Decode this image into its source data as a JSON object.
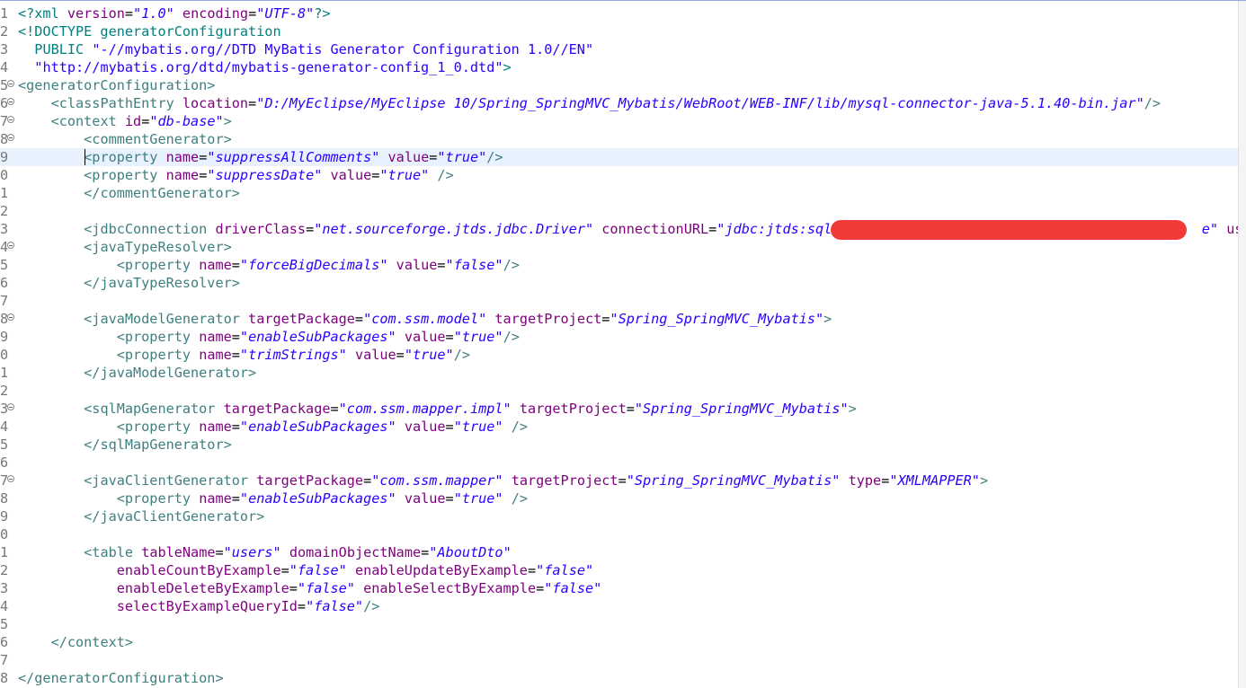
{
  "editor": {
    "active_line": 9,
    "lines": [
      {
        "n": "1",
        "fold": false,
        "html": "<span class=\"d\">&lt;?xml</span> <span class=\"a\">version</span>=<span class=\"v\">\"1.0\"</span> <span class=\"a\">encoding</span>=<span class=\"v\">\"UTF-8\"</span><span class=\"d\">?&gt;</span>"
      },
      {
        "n": "2",
        "fold": false,
        "html": "<span class=\"d\">&lt;!DOCTYPE generatorConfiguration</span>"
      },
      {
        "n": "3",
        "fold": false,
        "html": "  <span class=\"d\">PUBLIC</span> <span class=\"v\" style=\"font-style:normal\">\"-//mybatis.org//DTD MyBatis Generator Configuration 1.0//EN\"</span>"
      },
      {
        "n": "4",
        "fold": false,
        "html": "  <span class=\"v\" style=\"font-style:normal\">\"http://mybatis.org/dtd/mybatis-generator-config_1_0.dtd\"</span><span class=\"d\">&gt;</span>"
      },
      {
        "n": "5",
        "fold": true,
        "html": "<span class=\"t\">&lt;generatorConfiguration&gt;</span>"
      },
      {
        "n": "6",
        "fold": true,
        "html": "    <span class=\"t\">&lt;classPathEntry</span> <span class=\"a\">location</span>=<span class=\"v\">\"D:/MyEclipse/MyEclipse 10/Spring_SpringMVC_Mybatis/WebRoot/WEB-INF/lib/mysql-connector-java-5.1.40-bin.jar\"</span><span class=\"t\">/&gt;</span>"
      },
      {
        "n": "7",
        "fold": true,
        "html": "    <span class=\"t\">&lt;context</span> <span class=\"a\">id</span>=<span class=\"v\">\"db-base\"</span><span class=\"t\">&gt;</span>"
      },
      {
        "n": "8",
        "fold": true,
        "html": "        <span class=\"t\">&lt;commentGenerator&gt;</span>"
      },
      {
        "n": "9",
        "fold": false,
        "html": "        <span class=\"t\">&lt;property</span> <span class=\"a\">name</span>=<span class=\"v\">\"suppressAllComments\"</span> <span class=\"a\">value</span>=<span class=\"v\">\"true\"</span><span class=\"t\">/&gt;</span>"
      },
      {
        "n": "0",
        "fold": false,
        "html": "        <span class=\"t\">&lt;property</span> <span class=\"a\">name</span>=<span class=\"v\">\"suppressDate\"</span> <span class=\"a\">value</span>=<span class=\"v\">\"true\"</span> <span class=\"t\">/&gt;</span>"
      },
      {
        "n": "1",
        "fold": false,
        "html": "        <span class=\"t\">&lt;/commentGenerator&gt;</span>"
      },
      {
        "n": "2",
        "fold": false,
        "html": ""
      },
      {
        "n": "3",
        "fold": false,
        "html": "        <span class=\"t\">&lt;jdbcConnection</span> <span class=\"a\">driverClass</span>=<span class=\"v\">\"net.sourceforge.jtds.jdbc.Driver\"</span> <span class=\"a\">connectionURL</span>=<span class=\"v\">\"jdbc:jtds:sqlserv</span>                                         <span class=\"v\">e\"</span> <span class=\"a\">user</span>"
      },
      {
        "n": "4",
        "fold": true,
        "html": "        <span class=\"t\">&lt;javaTypeResolver&gt;</span>"
      },
      {
        "n": "5",
        "fold": false,
        "html": "            <span class=\"t\">&lt;property</span> <span class=\"a\">name</span>=<span class=\"v\">\"forceBigDecimals\"</span> <span class=\"a\">value</span>=<span class=\"v\">\"false\"</span><span class=\"t\">/&gt;</span>"
      },
      {
        "n": "6",
        "fold": false,
        "html": "        <span class=\"t\">&lt;/javaTypeResolver&gt;</span>"
      },
      {
        "n": "7",
        "fold": false,
        "html": ""
      },
      {
        "n": "8",
        "fold": true,
        "html": "        <span class=\"t\">&lt;javaModelGenerator</span> <span class=\"a\">targetPackage</span>=<span class=\"v\">\"com.ssm.model\"</span> <span class=\"a\">targetProject</span>=<span class=\"v\">\"Spring_SpringMVC_Mybatis\"</span><span class=\"t\">&gt;</span>"
      },
      {
        "n": "9",
        "fold": false,
        "html": "            <span class=\"t\">&lt;property</span> <span class=\"a\">name</span>=<span class=\"v\">\"enableSubPackages\"</span> <span class=\"a\">value</span>=<span class=\"v\">\"true\"</span><span class=\"t\">/&gt;</span>"
      },
      {
        "n": "0",
        "fold": false,
        "html": "            <span class=\"t\">&lt;property</span> <span class=\"a\">name</span>=<span class=\"v\">\"trimStrings\"</span> <span class=\"a\">value</span>=<span class=\"v\">\"true\"</span><span class=\"t\">/&gt;</span>"
      },
      {
        "n": "1",
        "fold": false,
        "html": "        <span class=\"t\">&lt;/javaModelGenerator&gt;</span>"
      },
      {
        "n": "2",
        "fold": false,
        "html": ""
      },
      {
        "n": "3",
        "fold": true,
        "html": "        <span class=\"t\">&lt;sqlMapGenerator</span> <span class=\"a\">targetPackage</span>=<span class=\"v\">\"com.ssm.mapper.impl\"</span> <span class=\"a\">targetProject</span>=<span class=\"v\">\"Spring_SpringMVC_Mybatis\"</span><span class=\"t\">&gt;</span>"
      },
      {
        "n": "4",
        "fold": false,
        "html": "            <span class=\"t\">&lt;property</span> <span class=\"a\">name</span>=<span class=\"v\">\"enableSubPackages\"</span> <span class=\"a\">value</span>=<span class=\"v\">\"true\"</span> <span class=\"t\">/&gt;</span>"
      },
      {
        "n": "5",
        "fold": false,
        "html": "        <span class=\"t\">&lt;/sqlMapGenerator&gt;</span>"
      },
      {
        "n": "6",
        "fold": false,
        "html": ""
      },
      {
        "n": "7",
        "fold": true,
        "html": "        <span class=\"t\">&lt;javaClientGenerator</span> <span class=\"a\">targetPackage</span>=<span class=\"v\">\"com.ssm.mapper\"</span> <span class=\"a\">targetProject</span>=<span class=\"v\">\"Spring_SpringMVC_Mybatis\"</span> <span class=\"a\">type</span>=<span class=\"v\">\"XMLMAPPER\"</span><span class=\"t\">&gt;</span>"
      },
      {
        "n": "8",
        "fold": false,
        "html": "            <span class=\"t\">&lt;property</span> <span class=\"a\">name</span>=<span class=\"v\">\"enableSubPackages\"</span> <span class=\"a\">value</span>=<span class=\"v\">\"true\"</span> <span class=\"t\">/&gt;</span>"
      },
      {
        "n": "9",
        "fold": false,
        "html": "        <span class=\"t\">&lt;/javaClientGenerator&gt;</span>"
      },
      {
        "n": "0",
        "fold": false,
        "html": ""
      },
      {
        "n": "1",
        "fold": false,
        "html": "        <span class=\"t\">&lt;table</span> <span class=\"a\">tableName</span>=<span class=\"v\">\"users\"</span> <span class=\"a\">domainObjectName</span>=<span class=\"v\">\"AboutDto\"</span>"
      },
      {
        "n": "2",
        "fold": false,
        "html": "            <span class=\"a\">enableCountByExample</span>=<span class=\"v\">\"false\"</span> <span class=\"a\">enableUpdateByExample</span>=<span class=\"v\">\"false\"</span>"
      },
      {
        "n": "3",
        "fold": false,
        "html": "            <span class=\"a\">enableDeleteByExample</span>=<span class=\"v\">\"false\"</span> <span class=\"a\">enableSelectByExample</span>=<span class=\"v\">\"false\"</span>"
      },
      {
        "n": "4",
        "fold": false,
        "html": "            <span class=\"a\">selectByExampleQueryId</span>=<span class=\"v\">\"false\"</span><span class=\"t\">/&gt;</span>"
      },
      {
        "n": "5",
        "fold": false,
        "html": ""
      },
      {
        "n": "6",
        "fold": false,
        "html": "    <span class=\"t\">&lt;/context&gt;</span>"
      },
      {
        "n": "7",
        "fold": false,
        "html": ""
      },
      {
        "n": "8",
        "fold": false,
        "html": "<span class=\"t\">&lt;/generatorConfiguration&gt;</span>"
      }
    ]
  }
}
